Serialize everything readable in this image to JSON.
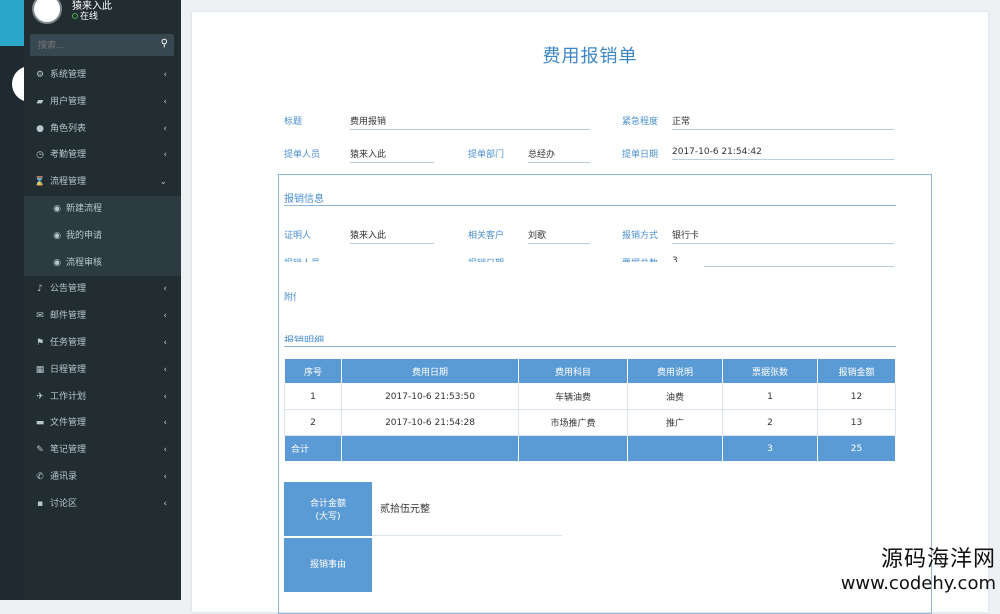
{
  "sidebar": {
    "user_name": "猿来入此",
    "status": "在线",
    "search_placeholder": "搜索...",
    "menu": [
      {
        "icon": "gear-icon",
        "glyph": "⚙",
        "label": "系统管理"
      },
      {
        "icon": "users-icon",
        "glyph": "▰",
        "label": "用户管理"
      },
      {
        "icon": "user-icon",
        "glyph": "●",
        "label": "角色列表"
      },
      {
        "icon": "clock-icon",
        "glyph": "◷",
        "label": "考勤管理"
      },
      {
        "icon": "hourglass-icon",
        "glyph": "⌛",
        "label": "流程管理"
      }
    ],
    "submenu": [
      {
        "label": "新建流程"
      },
      {
        "label": "我的申请"
      },
      {
        "label": "流程审核"
      }
    ],
    "menu2": [
      {
        "icon": "bell-icon",
        "glyph": "♪",
        "label": "公告管理"
      },
      {
        "icon": "mail-icon",
        "glyph": "✉",
        "label": "邮件管理"
      },
      {
        "icon": "flag-icon",
        "glyph": "⚑",
        "label": "任务管理"
      },
      {
        "icon": "calendar-icon",
        "glyph": "▦",
        "label": "日程管理"
      },
      {
        "icon": "plane-icon",
        "glyph": "✈",
        "label": "工作计划"
      },
      {
        "icon": "folder-icon",
        "glyph": "▬",
        "label": "文件管理"
      },
      {
        "icon": "edit-icon",
        "glyph": "✎",
        "label": "笔记管理"
      },
      {
        "icon": "phone-icon",
        "glyph": "✆",
        "label": "通讯录"
      },
      {
        "icon": "comment-icon",
        "glyph": "▪",
        "label": "讨论区"
      }
    ]
  },
  "form": {
    "title": "费用报销单",
    "title_label": "标题",
    "title_value": "费用报销",
    "urgency_label": "紧急程度",
    "urgency_value": "正常",
    "submitter_label": "提单人员",
    "submitter_value": "猿来入此",
    "dept_label": "提单部门",
    "dept_value": "总经办",
    "date_label": "提单日期",
    "date_value": "2017-10-6 21:54:42",
    "section_info": "报销信息",
    "witness_label": "证明人",
    "witness_value": "猿来入此",
    "customer_label": "相关客户",
    "customer_value": "刘歌",
    "method_label": "报销方式",
    "method_value": "银行卡",
    "reimburser_label": "报销人员",
    "reimburse_date_label": "报销日期",
    "bill_count_label": "票据总数",
    "bill_count_value": "3",
    "attachment_label": "附件",
    "section_detail": "报销明细",
    "table": {
      "headers": [
        "序号",
        "费用日期",
        "费用科目",
        "费用说明",
        "票据张数",
        "报销金额"
      ],
      "rows": [
        [
          "1",
          "2017-10-6 21:53:50",
          "车辆油费",
          "油费",
          "1",
          "12"
        ],
        [
          "2",
          "2017-10-6 21:54:28",
          "市场推广费",
          "推广",
          "2",
          "13"
        ]
      ],
      "total": [
        "合计",
        "",
        "",
        "",
        "3",
        "25"
      ]
    },
    "sum_label": "合计金额\n(大写)",
    "sum_label_line1": "合计金额",
    "sum_label_line2": "(大写)",
    "sum_value": "贰拾伍元整",
    "reason_label": "报销事由"
  },
  "watermark": {
    "line1": "源码海洋网",
    "line2": "www.codehy.com"
  }
}
